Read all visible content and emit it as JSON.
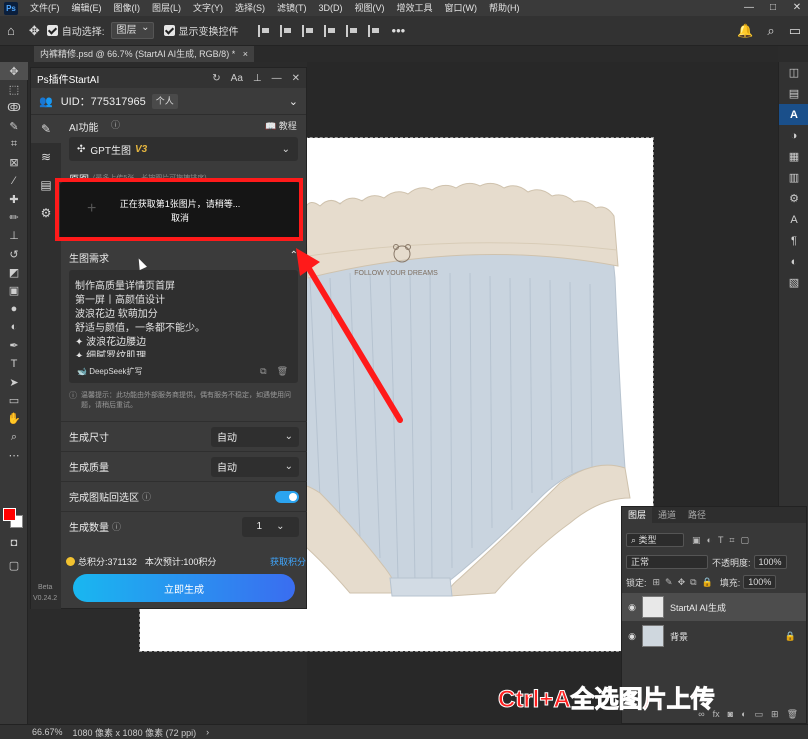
{
  "menubar": {
    "items": [
      "文件(F)",
      "编辑(E)",
      "图像(I)",
      "图层(L)",
      "文字(Y)",
      "选择(S)",
      "滤镜(T)",
      "3D(D)",
      "视图(V)",
      "增效工具",
      "窗口(W)",
      "帮助(H)"
    ]
  },
  "options": {
    "auto_select_label": "自动选择:",
    "auto_select_value": "图层",
    "show_transform_label": "显示变换控件"
  },
  "document": {
    "tab_title": "内裤精修.psd @ 66.7% (StartAI AI生成, RGB/8) *",
    "close": "×"
  },
  "plugin": {
    "title": "Ps插件StartAI",
    "uid_label": "UID：775317965",
    "account_badge": "个人",
    "ai_function_label": "AI功能",
    "tutorial_link": "教程",
    "model_name": "GPT生图",
    "model_version": "V3",
    "ref_label": "原图",
    "ref_hint": "(最多上传5张，长按图片可拖拽排序)",
    "loading_text": "正在获取第1张图片，请稍等...",
    "cancel_text": "取消",
    "requirements_title": "生图需求",
    "requirements_lines": [
      "制作高质量详情页首屏",
      "第一屏丨高颜值设计",
      "波浪花边 软萌加分",
      "舒适与颜值，一条都不能少。",
      "✦ 波浪花边腰边",
      "✦ 细腻罗纹肌理"
    ],
    "deepseek_label": "DeepSeek扩写",
    "notice": "温馨提示：此功能由外部服务商提供，偶有服务不稳定，如遇使用问题，请稍后重试。",
    "size_label": "生成尺寸",
    "size_value": "自动",
    "quality_label": "生成质量",
    "quality_value": "自动",
    "paste_back_label": "完成图贴回选区",
    "paste_back_on": true,
    "count_label": "生成数量",
    "count_value": "1",
    "total_points": "总积分:371132",
    "estimate": "本次预计:100积分",
    "get_points": "获取积分",
    "generate_button": "立即生成",
    "beta": "Beta",
    "version": "V0.24.2"
  },
  "product": {
    "waistband_text": "FOLLOW YOUR DREAMS"
  },
  "layers": {
    "tabs": [
      "图层",
      "通道",
      "路径"
    ],
    "filter_kind": "类型",
    "blend_mode": "正常",
    "opacity_label": "不透明度:",
    "opacity_value": "100%",
    "lock_label": "锁定:",
    "fill_label": "填充:",
    "fill_value": "100%",
    "items": [
      {
        "name": "StartAI AI生成",
        "selected": true
      },
      {
        "name": "背景",
        "selected": false
      }
    ]
  },
  "status": {
    "zoom": "66.67%",
    "doc_info": "1080 像素 x 1080 像素 (72 ppi)"
  },
  "caption": "Ctrl+A全选图片上传",
  "colors": {
    "foreground": "#ff0000",
    "background": "#ffffff",
    "accent": "#2ba4f0",
    "highlight_box": "#ff1a1a"
  }
}
